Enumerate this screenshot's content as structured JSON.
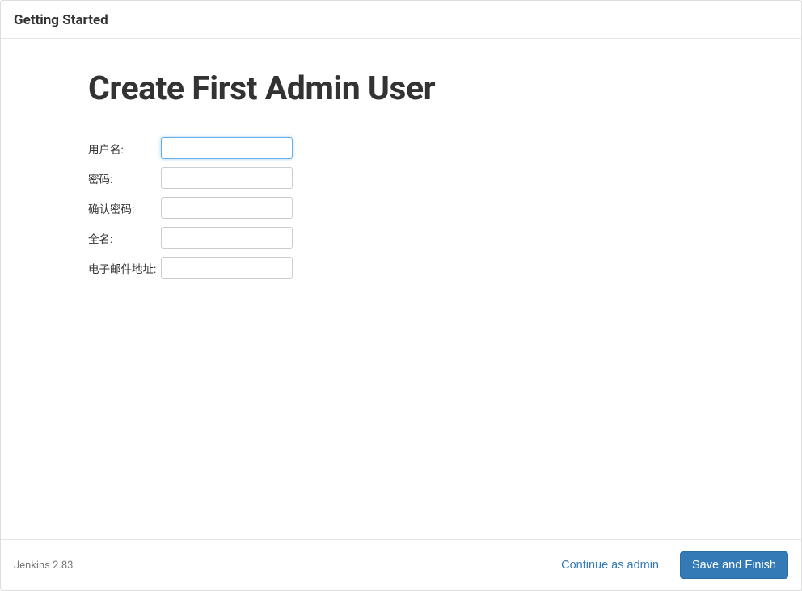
{
  "header": {
    "title": "Getting Started"
  },
  "main": {
    "title": "Create First Admin User",
    "fields": {
      "username": {
        "label": "用户名:",
        "value": ""
      },
      "password": {
        "label": "密码:",
        "value": ""
      },
      "confirm_password": {
        "label": "确认密码:",
        "value": ""
      },
      "fullname": {
        "label": "全名:",
        "value": ""
      },
      "email": {
        "label": "电子邮件地址:",
        "value": ""
      }
    }
  },
  "footer": {
    "version": "Jenkins 2.83",
    "continue_label": "Continue as admin",
    "save_label": "Save and Finish"
  }
}
